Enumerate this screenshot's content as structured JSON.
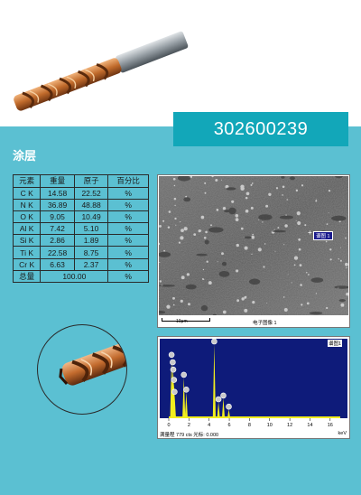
{
  "product_code": "302600239",
  "section_title": "涂层",
  "table": {
    "headers": [
      "元素",
      "重量",
      "原子",
      "百分比"
    ],
    "rows": [
      {
        "element": "C K",
        "weight": "14.58",
        "atomic": "22.52",
        "unit": "%"
      },
      {
        "element": "N K",
        "weight": "36.89",
        "atomic": "48.88",
        "unit": "%"
      },
      {
        "element": "O K",
        "weight": "9.05",
        "atomic": "10.49",
        "unit": "%"
      },
      {
        "element": "Al K",
        "weight": "7.42",
        "atomic": "5.10",
        "unit": "%"
      },
      {
        "element": "Si K",
        "weight": "2.86",
        "atomic": "1.89",
        "unit": "%"
      },
      {
        "element": "Ti K",
        "weight": "22.58",
        "atomic": "8.75",
        "unit": "%"
      },
      {
        "element": "Cr K",
        "weight": "6.63",
        "atomic": "2.37",
        "unit": "%"
      }
    ],
    "total_label": "总量",
    "total_value": "100.00",
    "total_unit": "%"
  },
  "sem": {
    "scale": "10μm",
    "caption": "电子图像 1",
    "spot_label": "谱图 1"
  },
  "eds": {
    "spot_label": "谱图1",
    "footer": "满量程 779 cts 光标: 0.000",
    "x_unit": "keV",
    "x_ticks": [
      "0",
      "2",
      "4",
      "6",
      "8",
      "10",
      "12",
      "14",
      "16"
    ]
  },
  "colors": {
    "teal_background": "#5bc0d2",
    "code_box": "#12a7b9",
    "spectrum_bg": "#0e1b7a",
    "spectrum_peaks": "#f2ee1e"
  }
}
